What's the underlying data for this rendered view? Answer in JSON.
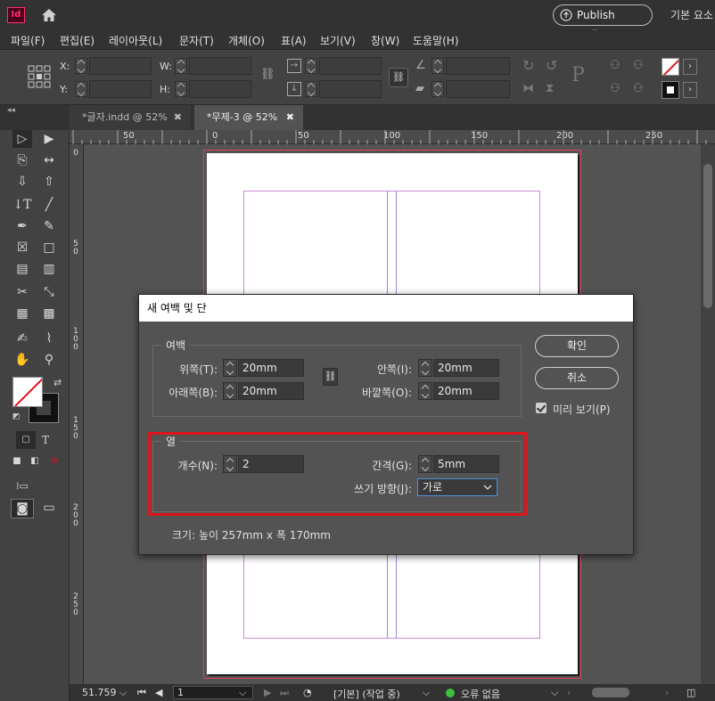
{
  "app": {
    "logo": "Id",
    "publish_label": "Publish Online",
    "workspace": "기본 요소"
  },
  "menu": [
    "파일(F)",
    "편집(E)",
    "레이아웃(L)",
    "문자(T)",
    "개체(O)",
    "표(A)",
    "보기(V)",
    "창(W)",
    "도움말(H)"
  ],
  "control": {
    "x_label": "X:",
    "y_label": "Y:",
    "w_label": "W:",
    "h_label": "H:"
  },
  "tabs": [
    {
      "label": "*글자.indd @ 52%",
      "close": "✖"
    },
    {
      "label": "*무제-3 @ 52%",
      "close": "✖"
    }
  ],
  "ruler": {
    "h_ticks": [
      "50",
      "0",
      "50",
      "100",
      "150",
      "200",
      "250"
    ],
    "v_ticks": [
      "0",
      "5 0",
      "1 0 0",
      "1 5 0",
      "2 0 0",
      "2 5 0"
    ]
  },
  "dialog": {
    "title": "새 여백 및 단",
    "margins": {
      "label": "여백",
      "top_label": "위쪽(T):",
      "top_value": "20mm",
      "bottom_label": "아래쪽(B):",
      "bottom_value": "20mm",
      "inside_label": "안쪽(I):",
      "inside_value": "20mm",
      "outside_label": "바깥쪽(O):",
      "outside_value": "20mm"
    },
    "columns": {
      "label": "열",
      "count_label": "개수(N):",
      "count_value": "2",
      "gutter_label": "간격(G):",
      "gutter_value": "5mm",
      "direction_label": "쓰기 방향(J):",
      "direction_value": "가로"
    },
    "ok_label": "확인",
    "cancel_label": "취소",
    "preview_label": "미리 보기(P)",
    "preview_checked": true,
    "size_text": "크기: 높이 257mm x 폭 170mm"
  },
  "status": {
    "zoom": "51.759",
    "page": "1",
    "master": "[기본] (작업 중)",
    "errors": "오류 없음",
    "error_color": "#3fbf3f"
  },
  "colors": {
    "accent": "#ff3366",
    "highlight": "#e0131b"
  }
}
